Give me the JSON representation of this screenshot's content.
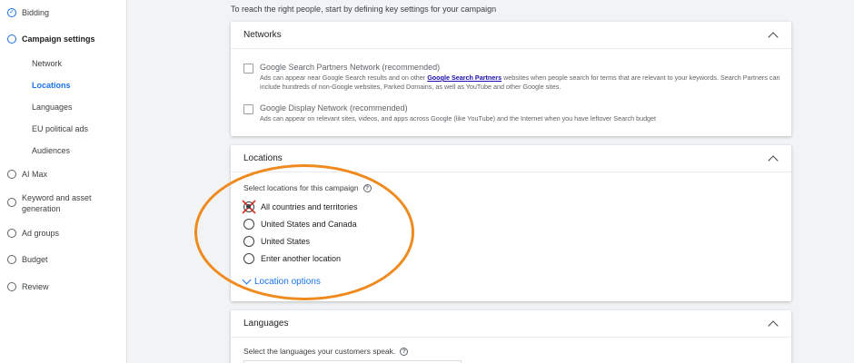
{
  "sidebar": {
    "items": [
      {
        "label": "Bidding"
      },
      {
        "label": "Campaign settings"
      },
      {
        "label": "AI Max"
      },
      {
        "label": "Keyword and asset generation"
      },
      {
        "label": "Ad groups"
      },
      {
        "label": "Budget"
      },
      {
        "label": "Review"
      }
    ],
    "sub_items": [
      {
        "label": "Network"
      },
      {
        "label": "Locations"
      },
      {
        "label": "Languages"
      },
      {
        "label": "EU political ads"
      },
      {
        "label": "Audiences"
      }
    ],
    "active_sub_item": "Locations"
  },
  "main": {
    "intro": "To reach the right people, start by defining key settings for your campaign",
    "networks": {
      "title": "Networks",
      "options": [
        {
          "label": "Google Search Partners Network (recommended)",
          "desc_before": "Ads can appear near Google Search results and on other ",
          "link": "Google Search Partners",
          "desc_after": " websites when people search for terms that are relevant to your keywords. Search Partners can include hundreds of non-Google websites, Parked Domains, as well as YouTube and other Google sites.",
          "checked": false
        },
        {
          "label": "Google Display Network (recommended)",
          "desc_before": "Ads can appear on relevant sites, videos, and apps across Google (like YouTube) and the Internet when you have leftover Search budget",
          "checked": false
        }
      ]
    },
    "locations": {
      "title": "Locations",
      "prompt": "Select locations for this campaign",
      "options": [
        {
          "label": "All countries and territories",
          "selected": true
        },
        {
          "label": "United States and Canada",
          "selected": false
        },
        {
          "label": "United States",
          "selected": false
        },
        {
          "label": "Enter another location",
          "selected": false
        }
      ],
      "more_link": "Location options"
    },
    "languages": {
      "title": "Languages",
      "prompt": "Select the languages your customers speak."
    }
  },
  "colors": {
    "accent": "#1a73e8",
    "highlight_oval": "#ef8a1f",
    "x_mark": "#d93025"
  }
}
